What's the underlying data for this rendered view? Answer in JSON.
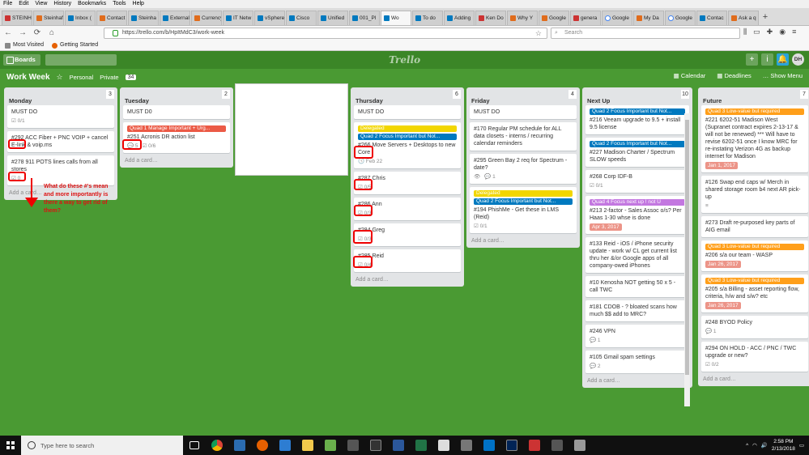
{
  "menubar": [
    "File",
    "Edit",
    "View",
    "History",
    "Bookmarks",
    "Tools",
    "Help"
  ],
  "tabs": [
    {
      "label": "STEINH",
      "icon": "r"
    },
    {
      "label": "Steinhafels",
      "icon": "o"
    },
    {
      "label": "Inbox (",
      "icon": "b"
    },
    {
      "label": "Contact",
      "icon": "o"
    },
    {
      "label": "Steinha",
      "icon": "b"
    },
    {
      "label": "External",
      "icon": "b"
    },
    {
      "label": "Currency",
      "icon": "o"
    },
    {
      "label": "IT Netw",
      "icon": "b"
    },
    {
      "label": "vSphere",
      "icon": "b"
    },
    {
      "label": "Cisco",
      "icon": "b"
    },
    {
      "label": "Unified",
      "icon": "b"
    },
    {
      "label": "001_Pl",
      "icon": "b"
    },
    {
      "label": "Wo",
      "icon": "b",
      "active": true
    },
    {
      "label": "To do",
      "icon": "b"
    },
    {
      "label": "Adding",
      "icon": "b"
    },
    {
      "label": "Ken Do",
      "icon": "r"
    },
    {
      "label": "Why Y",
      "icon": "o"
    },
    {
      "label": "Google",
      "icon": "o"
    },
    {
      "label": "genera",
      "icon": "r"
    },
    {
      "label": "Google",
      "icon": "g"
    },
    {
      "label": "My Da",
      "icon": "o"
    },
    {
      "label": "Google",
      "icon": "g"
    },
    {
      "label": "Contac",
      "icon": "b"
    },
    {
      "label": "Ask a q",
      "icon": "o"
    }
  ],
  "nav": {
    "url": "https://trello.com/b/HpItMdC3/work-week",
    "search_placeholder": "Search"
  },
  "bookmarks": [
    {
      "label": "Most Visited"
    },
    {
      "label": "Getting Started"
    }
  ],
  "trello_header": {
    "boards_label": "Boards",
    "logo": "Trello",
    "avatar": "DH"
  },
  "board": {
    "title": "Work Week",
    "team": "Personal",
    "visibility": "Private",
    "count": "34",
    "calendar": "Calendar",
    "deadlines": "Deadlines",
    "show_menu": "Show Menu"
  },
  "lists": [
    {
      "title": "Monday",
      "count": "3",
      "cards": [
        {
          "text": "MUST DO",
          "badges": [
            "☑ 0/1"
          ]
        },
        {
          "text": "#292 ACC Fiber + PNC VOIP + cancel E-link & voip.ms",
          "badges": []
        },
        {
          "text": "#278 911 POTS lines calls from all stores",
          "badges": [
            "☑ 0"
          ]
        }
      ]
    },
    {
      "title": "Tuesday",
      "count": "2",
      "cards": [
        {
          "text": "MUST D0",
          "badges": []
        },
        {
          "label": {
            "text": "Quad 1 Manage Important + Urg...",
            "color": "#eb5a46"
          },
          "text": "#251 Acronis DR action list",
          "badges": [
            "💬 5",
            "☑ 0/6"
          ]
        }
      ]
    },
    {
      "title": "Thursday",
      "count": "6",
      "cards": [
        {
          "text": "MUST DO",
          "badges": []
        },
        {
          "label": {
            "text": "Delegated",
            "color": "#f2d600"
          },
          "label2": {
            "text": "Quad 2 Focus Important but Not...",
            "color": "#0079bf"
          },
          "text": "#266 Move Servers + Desktops to new Core",
          "badges": [
            "🕓 Feb 22"
          ]
        },
        {
          "text": "#287 Chris",
          "badges": [
            "☑ 0/5"
          ]
        },
        {
          "text": "#286 Ann",
          "badges": [
            "☑ 0/3"
          ]
        },
        {
          "text": "#284 Greg",
          "badges": [
            "☑ 0/3"
          ]
        },
        {
          "text": "#285 Reid",
          "badges": [
            "☑ 0/4"
          ]
        }
      ]
    },
    {
      "title": "Friday",
      "count": "4",
      "cards": [
        {
          "text": "MUST DO",
          "badges": []
        },
        {
          "text": "#170 Regular PM schedule for ALL data closets - interns / recurring calendar reminders",
          "badges": []
        },
        {
          "text": "#295 Green Bay 2 req for Spectrum - date?",
          "badges": [
            "👁",
            "💬 1"
          ]
        },
        {
          "label": {
            "text": "Delegated",
            "color": "#f2d600"
          },
          "label2": {
            "text": "Quad 2 Focus Important but Not...",
            "color": "#0079bf"
          },
          "text": "#194 PhishMe - Get these in LMS (Reid)",
          "badges": [
            "☑ 0/1"
          ]
        }
      ]
    },
    {
      "title": "Next Up",
      "count": "10",
      "cards": [
        {
          "label": {
            "text": "Quad 2 Focus Important but Not...",
            "color": "#0079bf"
          },
          "text": "#216 Veeam upgrade to 9.5 + install 9.5 license",
          "badges": []
        },
        {
          "label": {
            "text": "Quad 2 Focus Important but Not...",
            "color": "#0079bf"
          },
          "text": "#227 Madison Charter / Spectrum SLOW speeds",
          "badges": []
        },
        {
          "text": "#268 Corp IDF-B",
          "badges": [
            "☑ 0/1"
          ]
        },
        {
          "label": {
            "text": "Quad 4 Focus next up ! not U",
            "color": "#c377e0"
          },
          "text": "#213 2-factor - Sales Assoc o/s? Per Haas 1-30 whse is done",
          "due": "Apr 3, 2017",
          "badges": []
        },
        {
          "text": "#133 Reid - iOS / iPhone security update - work w/ CL get current list thru her &/or Google apps of all company-owed iPhones",
          "badges": []
        },
        {
          "text": "#10 Kenosha NOT getting 50 x 5 - call TWC",
          "badges": []
        },
        {
          "text": "#181 CDOB - ? bloated scans how much $$ add to MRC?",
          "badges": []
        },
        {
          "text": "#246 VPN",
          "badges": [
            "💬 1"
          ]
        },
        {
          "text": "#105 Gmail spam settings",
          "badges": [
            "💬 2"
          ]
        }
      ]
    },
    {
      "title": "Future",
      "count": "7",
      "cards": [
        {
          "label": {
            "text": "Quad 3 Low-value but required",
            "color": "#ff9f1a"
          },
          "text": "#221 6202-51 Madison West (Supranet contract expires 2-13-17 & will not be renewed) *** Will have to revise 6202-51 once I know MRC for re-instating Verizon 4G as backup internet for Madison",
          "due": "Jan 1, 2017",
          "badges": []
        },
        {
          "text": "#126 Swap end caps w/ Merch in shared storage room b4 next AR pick-up",
          "badges": [
            "≡"
          ]
        },
        {
          "text": "#273 Draft re-purposed key parts of AIG email",
          "badges": []
        },
        {
          "label": {
            "text": "Quad 3 Low-value but required",
            "color": "#ff9f1a"
          },
          "text": "#206 s/a our team - WASP",
          "due": "Jan 26, 2017",
          "badges": []
        },
        {
          "label": {
            "text": "Quad 3 Low-value but required",
            "color": "#ff9f1a"
          },
          "text": "#205 s/a Billing - asset reporting flow, criteria, h/w and s/w? etc",
          "due": "Jan 26, 2017",
          "badges": []
        },
        {
          "text": "#248 BYOD Policy",
          "badges": [
            "💬 1"
          ]
        },
        {
          "text": "#294 ON HOLD - ACC / PNC / TWC upgrade or new?",
          "badges": [
            "☑ 0/2"
          ]
        }
      ]
    }
  ],
  "add_card": "Add a card…",
  "annotation": "What do these #'s mean and more importantly is there a way to get rid of them?",
  "taskbar": {
    "search_placeholder": "Type here to search",
    "time": "2:58 PM",
    "date": "2/13/2018"
  }
}
